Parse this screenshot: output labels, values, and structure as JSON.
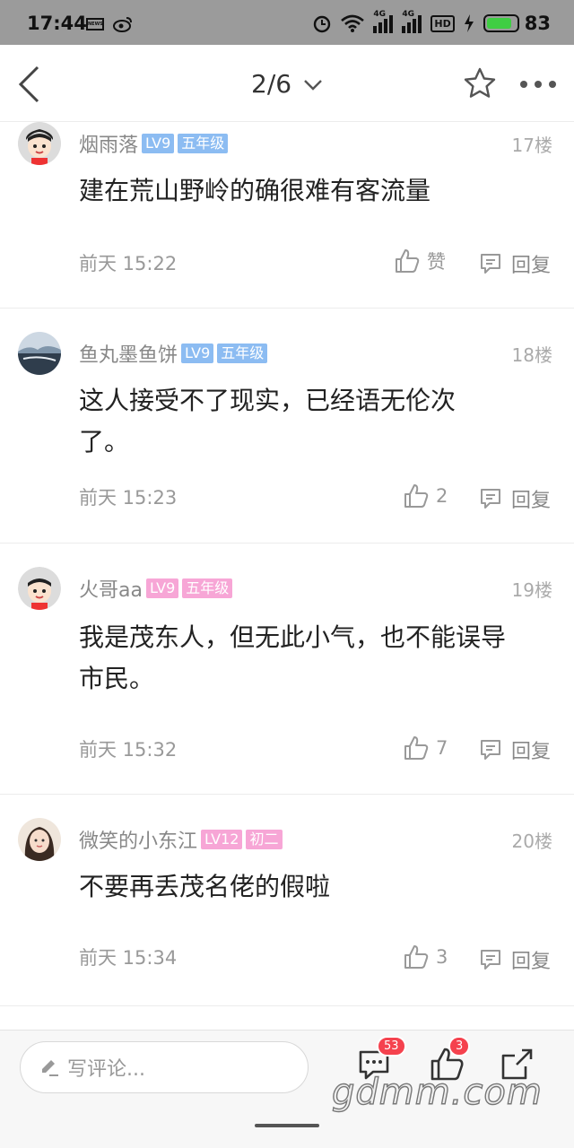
{
  "status_bar": {
    "time": "17:44",
    "news_icon": "news-icon",
    "weibo_icon": "weibo-icon",
    "signal_tag_1": "4G",
    "signal_tag_2": "4G",
    "hd_tag": "HD",
    "battery_level": "83",
    "battery_color": "#3fce43"
  },
  "nav": {
    "pager": "2/6",
    "icons": [
      "back-icon",
      "chevron-down-icon",
      "star-icon",
      "more-icon"
    ]
  },
  "comments": [
    {
      "username": "烟雨落",
      "level": "LV9",
      "grade": "五年级",
      "floor": "17楼",
      "text": "建在荒山野岭的确很难有客流量",
      "time": "前天 15:22",
      "like": "赞",
      "reply": "回复",
      "tag_color": "blue"
    },
    {
      "username": "鱼丸墨鱼饼",
      "level": "LV9",
      "grade": "五年级",
      "floor": "18楼",
      "text": "这人接受不了现实，已经语无伦次了。",
      "time": "前天 15:23",
      "like": "2",
      "reply": "回复",
      "tag_color": "blue"
    },
    {
      "username": "火哥aa",
      "level": "LV9",
      "grade": "五年级",
      "floor": "19楼",
      "text": "我是茂东人，但无此小气，也不能误导市民。",
      "time": "前天 15:32",
      "like": "7",
      "reply": "回复",
      "tag_color": "pink"
    },
    {
      "username": "微笑的小东江",
      "level": "LV12",
      "grade": "初二",
      "floor": "20楼",
      "text": "不要再丢茂名佬的假啦",
      "time": "前天 15:34",
      "like": "3",
      "reply": "回复",
      "tag_color": "pink"
    }
  ],
  "bottom_bar": {
    "input_placeholder": "写评论...",
    "comment_count": "53",
    "like_count": "3",
    "watermark": "gdmm.com"
  },
  "colors": {
    "level_blue": "#8cbcf2",
    "level_pink": "#f7a6d6",
    "badge_red": "#f5424e"
  }
}
